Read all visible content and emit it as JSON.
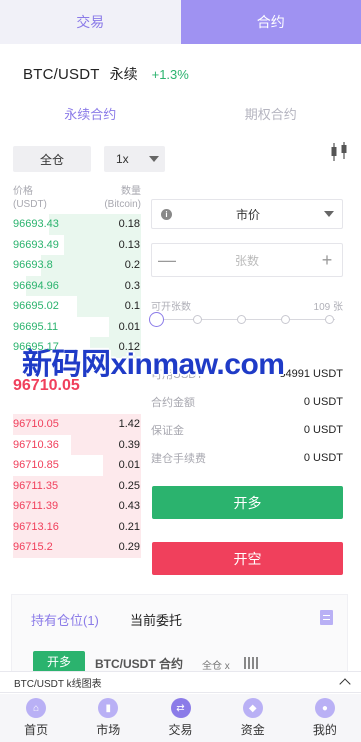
{
  "top_tabs": {
    "spot": "交易",
    "contract": "合约"
  },
  "pair": {
    "name": "BTC/USDT",
    "type": "永续",
    "change": "+1.3%"
  },
  "sub_tabs": {
    "perpetual": "永续合约",
    "futures": "期权合约"
  },
  "controls": {
    "margin_mode": "全仓",
    "leverage": "1x"
  },
  "book_header": {
    "price_label": "价格",
    "price_unit": "(USDT)",
    "qty_label": "数量",
    "qty_unit": "(Bitcoin)"
  },
  "asks": [
    {
      "price": "96693.43",
      "qty": "0.18",
      "depth": 0.72
    },
    {
      "price": "96693.49",
      "qty": "0.13",
      "depth": 0.6
    },
    {
      "price": "96693.8",
      "qty": "0.2",
      "depth": 0.78
    },
    {
      "price": "96694.96",
      "qty": "0.3",
      "depth": 0.9
    },
    {
      "price": "96695.02",
      "qty": "0.1",
      "depth": 0.5
    },
    {
      "price": "96695.11",
      "qty": "0.01",
      "depth": 0.25
    },
    {
      "price": "96695.17",
      "qty": "0.12",
      "depth": 0.4
    }
  ],
  "last_price": "96710.05",
  "bids": [
    {
      "price": "96710.05",
      "qty": "1.42",
      "depth": 1.0
    },
    {
      "price": "96710.36",
      "qty": "0.39",
      "depth": 0.55
    },
    {
      "price": "96710.85",
      "qty": "0.01",
      "depth": 0.3
    },
    {
      "price": "96711.35",
      "qty": "0.25",
      "depth": 1.0
    },
    {
      "price": "96711.39",
      "qty": "0.43",
      "depth": 1.0
    },
    {
      "price": "96713.16",
      "qty": "0.21",
      "depth": 1.0
    },
    {
      "price": "96715.2",
      "qty": "0.29",
      "depth": 1.0
    }
  ],
  "order_form": {
    "order_type": "市价",
    "qty_placeholder": "张数",
    "minus": "—",
    "plus": "+",
    "open_label": "可开张数",
    "open_value": "109 张",
    "slider_level": 0
  },
  "info_rows": [
    {
      "label": "可用USDT",
      "value": "34991 USDT"
    },
    {
      "label": "合约金额",
      "value": "0 USDT"
    },
    {
      "label": "保证金",
      "value": "0 USDT"
    },
    {
      "label": "建仓手续费",
      "value": "0 USDT"
    }
  ],
  "actions": {
    "long": "开多",
    "short": "开空"
  },
  "positions": {
    "tab_holdings": "持有仓位(1)",
    "tab_orders": "当前委托",
    "row_badge": "开多",
    "row_pair": "BTC/USDT 合约",
    "row_margin": "全仓 x"
  },
  "kline_bar": {
    "label": "BTC/USDT k线图表"
  },
  "nav": [
    {
      "label": "首页",
      "icon": "home-icon",
      "glyph": "⌂"
    },
    {
      "label": "市场",
      "icon": "market-icon",
      "glyph": "▮"
    },
    {
      "label": "交易",
      "icon": "trade-icon",
      "glyph": "⇄"
    },
    {
      "label": "资金",
      "icon": "wallet-icon",
      "glyph": "◆"
    },
    {
      "label": "我的",
      "icon": "user-icon",
      "glyph": "●"
    }
  ],
  "watermark": "新码网xinmaw.com",
  "colors": {
    "accent": "#8b7be8",
    "green": "#2bb36e",
    "red": "#f0405c"
  }
}
